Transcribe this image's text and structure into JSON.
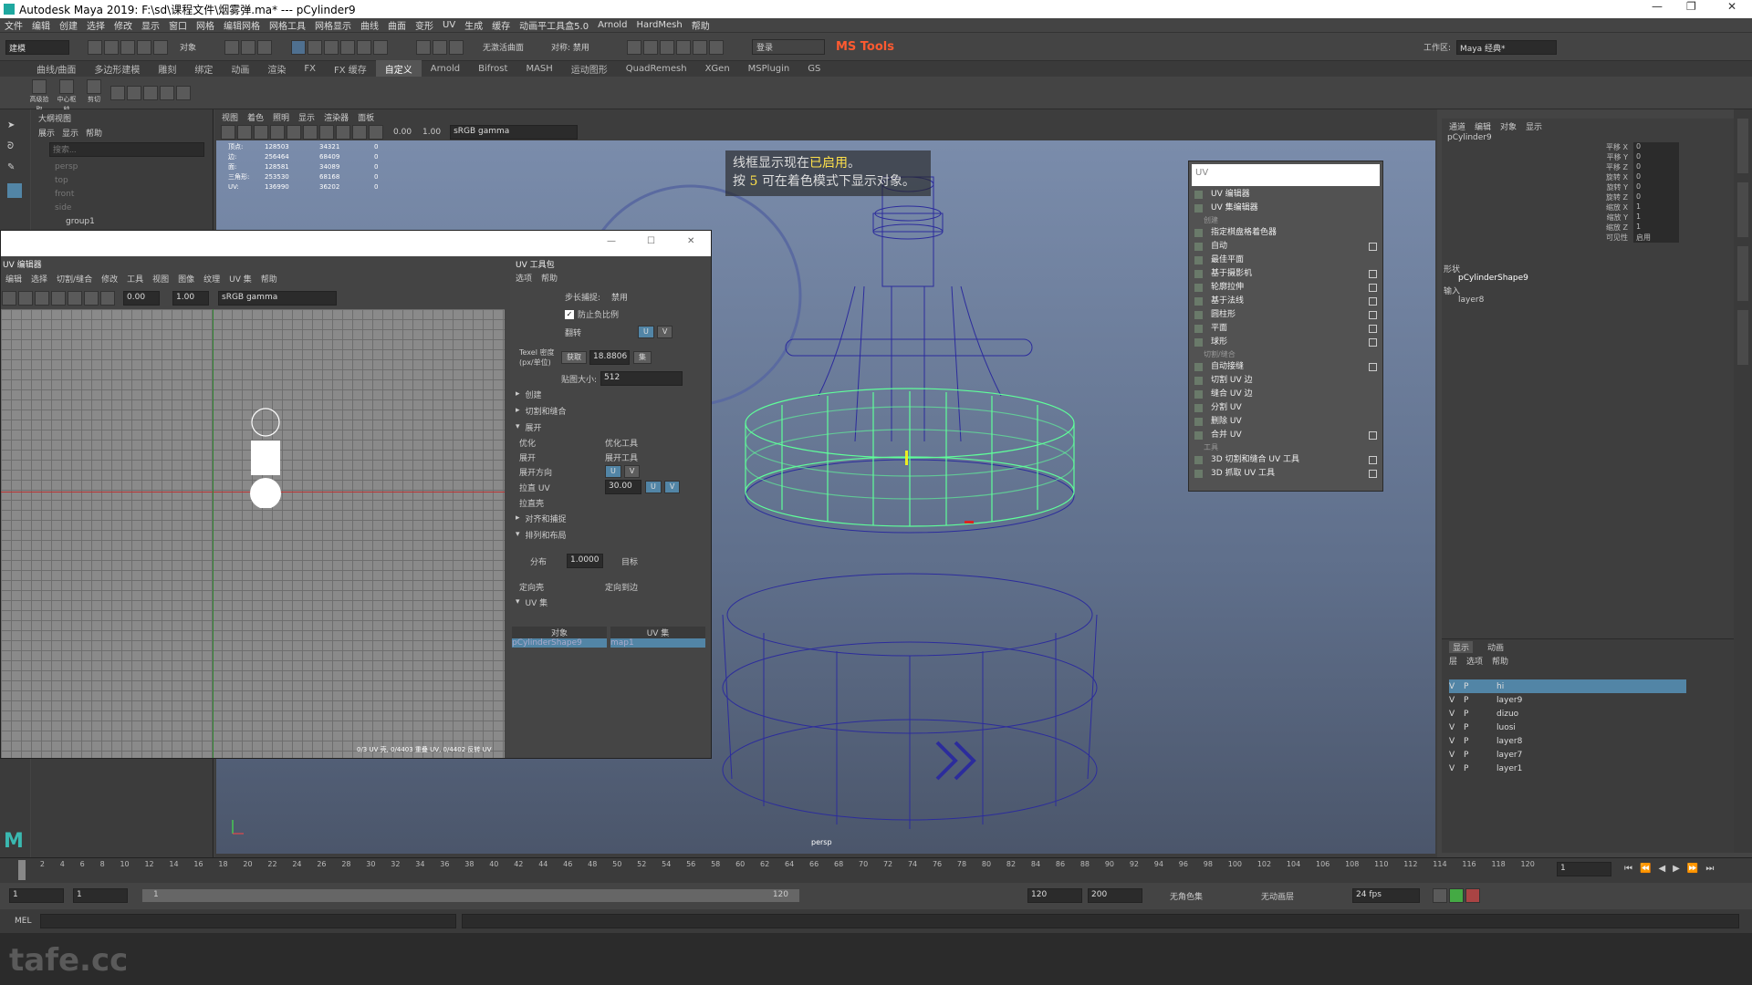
{
  "window": {
    "title": "Autodesk Maya 2019: F:\\sd\\课程文件\\烟雾弹.ma*  ---  pCylinder9"
  },
  "menubar": [
    "文件",
    "编辑",
    "创建",
    "选择",
    "修改",
    "显示",
    "窗口",
    "网格",
    "编辑网格",
    "网格工具",
    "网格显示",
    "曲线",
    "曲面",
    "变形",
    "UV",
    "生成",
    "缓存",
    "动画平工具盒5.0",
    "Arnold",
    "HardMesh",
    "帮助"
  ],
  "statusline": {
    "mode": "建模",
    "object_label": "对象",
    "no_live": "无激活曲面",
    "symmetry": "对称: 禁用",
    "login": "登录",
    "mstools": "MS Tools",
    "workspace_label": "工作区:",
    "workspace_value": "Maya 经典*"
  },
  "shelf": {
    "tabs": [
      "曲线/曲面",
      "多边形建模",
      "雕刻",
      "绑定",
      "动画",
      "渲染",
      "FX",
      "FX 缓存",
      "自定义",
      "Arnold",
      "Bifrost",
      "MASH",
      "运动图形",
      "QuadRemesh",
      "XGen",
      "MSPlugin",
      "GS"
    ],
    "active": "自定义",
    "icons": [
      "高级拾取",
      "中心枢轴",
      "剪切",
      "",
      "",
      "",
      "",
      ""
    ]
  },
  "outliner": {
    "title": "大纲视图",
    "menu": [
      "展示",
      "显示",
      "帮助"
    ],
    "search_placeholder": "搜索...",
    "items": [
      "persp",
      "top",
      "front",
      "side",
      "group1"
    ]
  },
  "viewport": {
    "menu": [
      "视图",
      "着色",
      "照明",
      "显示",
      "渲染器",
      "面板"
    ],
    "toolbar": {
      "value1": "0.00",
      "value2": "1.00",
      "colorspace": "sRGB gamma"
    },
    "stats": [
      [
        "顶点:",
        "128503",
        "34321",
        "0"
      ],
      [
        "边:",
        "256464",
        "68409",
        "0"
      ],
      [
        "面:",
        "128581",
        "34089",
        "0"
      ],
      [
        "三角形:",
        "253530",
        "68168",
        "0"
      ],
      [
        "UV:",
        "136990",
        "36202",
        "0"
      ]
    ],
    "msg_line1_a": "线框显示现在",
    "msg_line1_hl": "已启用",
    "msg_line1_b": "。",
    "msg_line2_a": "按 ",
    "msg_line2_hl": "5",
    "msg_line2_b": " 可在着色模式下显示对象。",
    "camera": "persp",
    "bg_colors": {
      "top": "#7a8cab",
      "bottom": "#4b566b",
      "wire": "#2c2c9c",
      "selected": "#5fff9a"
    }
  },
  "uvmenu": {
    "search": "UV",
    "items": [
      {
        "label": "UV 编辑器",
        "box": false
      },
      {
        "label": "UV 集编辑器",
        "box": false
      },
      {
        "section": "创建"
      },
      {
        "label": "指定棋盘格着色器",
        "box": false
      },
      {
        "label": "自动",
        "box": true
      },
      {
        "label": "最佳平面",
        "box": false
      },
      {
        "label": "基于摄影机",
        "box": true
      },
      {
        "label": "轮廓拉伸",
        "box": true
      },
      {
        "label": "基于法线",
        "box": true
      },
      {
        "label": "圆柱形",
        "box": true
      },
      {
        "label": "平面",
        "box": true
      },
      {
        "label": "球形",
        "box": true
      },
      {
        "section": "切割/缝合"
      },
      {
        "label": "自动接缝",
        "box": true
      },
      {
        "label": "切割 UV 边",
        "box": false
      },
      {
        "label": "缝合 UV 边",
        "box": false
      },
      {
        "label": "分割 UV",
        "box": false
      },
      {
        "label": "删除 UV",
        "box": false
      },
      {
        "label": "合并 UV",
        "box": true
      },
      {
        "section": "工具"
      },
      {
        "label": "3D 切割和缝合 UV 工具",
        "box": true
      },
      {
        "label": "3D 抓取 UV 工具",
        "box": true
      }
    ]
  },
  "uveditor": {
    "title": "UV 编辑器",
    "menu": [
      "编辑",
      "选择",
      "切割/缝合",
      "修改",
      "工具",
      "视图",
      "图像",
      "纹理",
      "UV 集",
      "帮助"
    ],
    "toolbar": {
      "value1": "0.00",
      "value2": "1.00",
      "colorspace": "sRGB gamma"
    },
    "status": "0/3 UV 壳, 0/4403 重叠 UV, 0/4402 反转 UV",
    "toolkit": {
      "title": "UV 工具包",
      "menu": [
        "选项",
        "帮助"
      ],
      "step_label": "步长捕捉:",
      "step_value": "禁用",
      "prevent_neg": "防止负比例",
      "flip": "翻转",
      "u": "U",
      "v": "V",
      "texel_label": "Texel 密度 (px/单位)",
      "get": "获取",
      "texel_value": "18.8806",
      "set": "集",
      "map_size_label": "贴图大小:",
      "map_size": "512",
      "sections": [
        "创建",
        "切割和缝合",
        "展开"
      ],
      "optimize": "优化",
      "optimize_tool": "优化工具",
      "unfold": "展开",
      "unfold_tool": "展开工具",
      "unfold_dir": "展开方向",
      "straighten": "拉直 UV",
      "straighten_value": "30.00",
      "straighten_shell": "拉直壳",
      "align_section": "对齐和捕捉",
      "arrange_section": "排列和布局",
      "distribute": "分布",
      "distribute_value": "1.0000",
      "target": "目标",
      "orient_shell": "定向壳",
      "orient_edge": "定向到边",
      "uvset_section": "UV 集",
      "col_object": "对象",
      "col_uvset": "UV 集",
      "row_object": "pCylinderShape9",
      "row_uvset": "map1"
    }
  },
  "channelbox": {
    "menu": [
      "通道",
      "编辑",
      "对象",
      "显示"
    ],
    "object": "pCylinder9",
    "attrs": [
      [
        "平移 X",
        "0"
      ],
      [
        "平移 Y",
        "0"
      ],
      [
        "平移 Z",
        "0"
      ],
      [
        "旋转 X",
        "0"
      ],
      [
        "旋转 Y",
        "0"
      ],
      [
        "旋转 Z",
        "0"
      ],
      [
        "缩放 X",
        "1"
      ],
      [
        "缩放 Y",
        "1"
      ],
      [
        "缩放 Z",
        "1"
      ],
      [
        "可见性",
        "启用"
      ]
    ],
    "shapes_label": "形状",
    "shape_name": "pCylinderShape9",
    "inputs_label": "输入",
    "input_name": "layer8"
  },
  "layers": {
    "tabs": [
      "显示",
      "动画"
    ],
    "menu": [
      "层",
      "选项",
      "帮助"
    ],
    "items": [
      {
        "name": "hi",
        "selected": true
      },
      {
        "name": "layer9",
        "selected": false
      },
      {
        "name": "dizuo",
        "selected": false
      },
      {
        "name": "luosi",
        "selected": false
      },
      {
        "name": "layer8",
        "selected": false
      },
      {
        "name": "layer7",
        "selected": false
      },
      {
        "name": "layer1",
        "selected": false
      }
    ]
  },
  "timeline": {
    "ticks": [
      "1",
      "2",
      "4",
      "6",
      "8",
      "10",
      "12",
      "14",
      "16",
      "18",
      "20",
      "22",
      "24",
      "26",
      "28",
      "30",
      "32",
      "34",
      "36",
      "38",
      "40",
      "42",
      "44",
      "46",
      "48",
      "50",
      "52",
      "54",
      "56",
      "58",
      "60",
      "62",
      "64",
      "66",
      "68",
      "70",
      "72",
      "74",
      "76",
      "78",
      "80",
      "82",
      "84",
      "86",
      "88",
      "90",
      "92",
      "94",
      "96",
      "98",
      "100",
      "102",
      "104",
      "106",
      "108",
      "110",
      "112",
      "114",
      "116",
      "118",
      "120"
    ],
    "current": "1"
  },
  "range": {
    "start": "1",
    "start2": "1",
    "range_start": "1",
    "range_end": "120",
    "end": "120",
    "end2": "200",
    "char_set": "无角色集",
    "anim_layer": "无动画层",
    "fps": "24 fps"
  },
  "cmdline": {
    "label": "MEL"
  },
  "watermark": "tafe.cc"
}
